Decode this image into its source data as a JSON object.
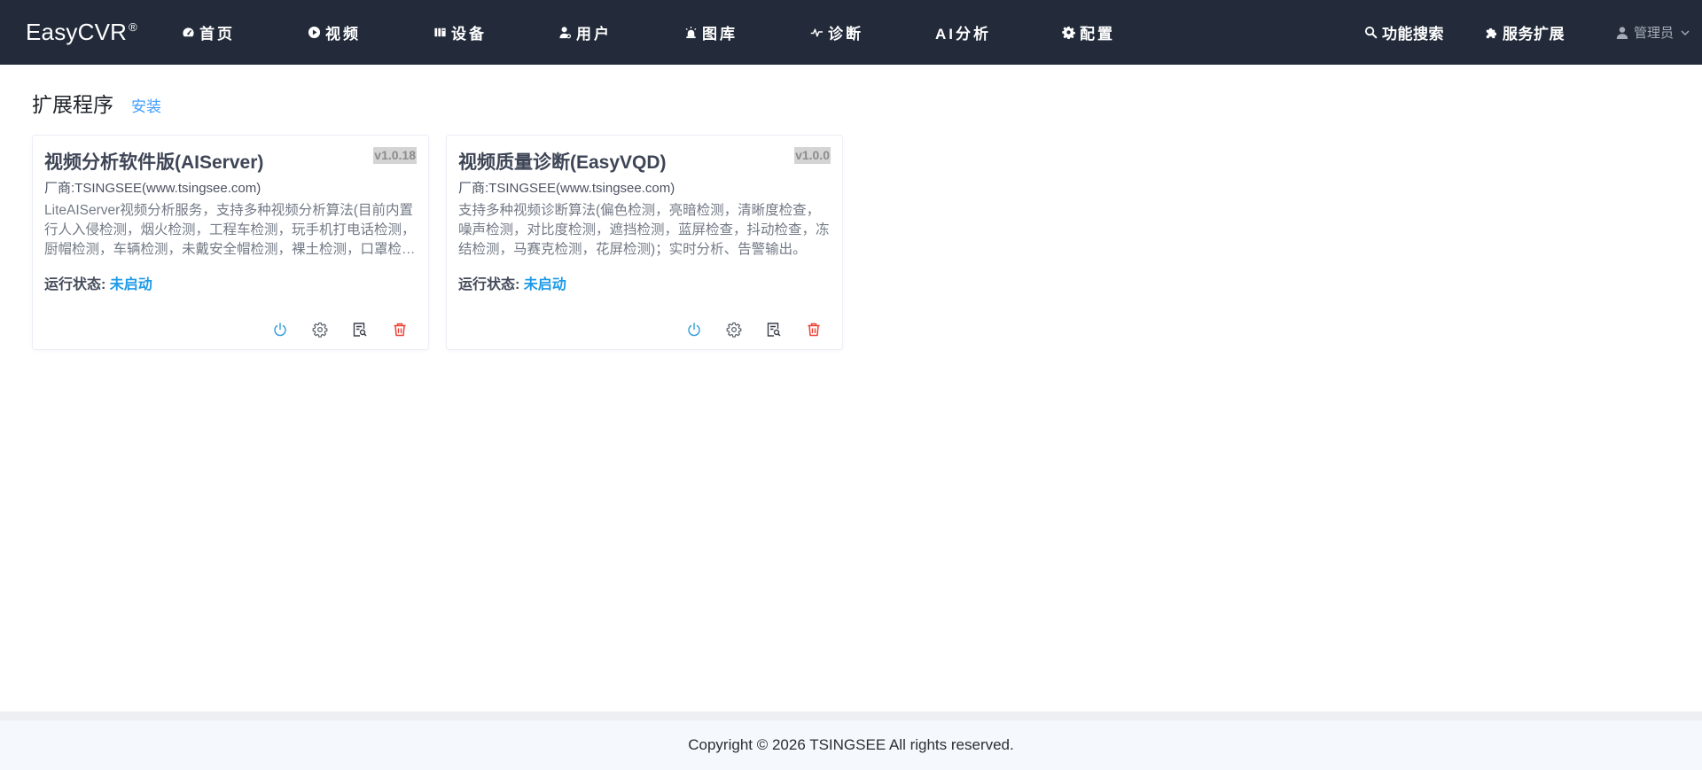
{
  "app": {
    "brand": "EasyCVR",
    "brand_mark": "®"
  },
  "nav": {
    "items": [
      {
        "label": "首页",
        "icon": "dashboard-icon"
      },
      {
        "label": "视频",
        "icon": "play-circle-icon"
      },
      {
        "label": "设备",
        "icon": "device-icon"
      },
      {
        "label": "用户",
        "icon": "user-icon"
      },
      {
        "label": "图库",
        "icon": "alarm-light-icon"
      },
      {
        "label": "诊断",
        "icon": "pulse-icon"
      },
      {
        "label": "AI分析",
        "icon": ""
      },
      {
        "label": "配置",
        "icon": "gear-icon"
      }
    ],
    "search_label": "功能搜索",
    "extensions_label": "服务扩展",
    "user_label": "管理员"
  },
  "page": {
    "title": "扩展程序",
    "install_label": "安装"
  },
  "cards": [
    {
      "name": "视频分析软件版(AIServer)",
      "version": "v1.0.18",
      "vendor": "厂商:TSINGSEE(www.tsingsee.com)",
      "description": "LiteAIServer视频分析服务，支持多种视频分析算法(目前内置行人入侵检测，烟火检测，工程车检测，玩手机打电话检测，厨帽检测，车辆检测，未戴安全帽检测，裸土检测，口罩检测等)",
      "status_label": "运行状态:",
      "status_value": "未启动"
    },
    {
      "name": "视频质量诊断(EasyVQD)",
      "version": "v1.0.0",
      "vendor": "厂商:TSINGSEE(www.tsingsee.com)",
      "description": "支持多种视频诊断算法(偏色检测，亮暗检测，清晰度检查，噪声检测，对比度检测，遮挡检测，蓝屏检查，抖动检查，冻结检测，马赛克检测，花屏检测)；实时分析、告警输出。",
      "status_label": "运行状态:",
      "status_value": "未启动"
    }
  ],
  "footer": {
    "copyright": "Copyright © 2026 TSINGSEE All rights reserved."
  },
  "colors": {
    "topbar": "#232b3a",
    "accent": "#409eff",
    "status": "#1d9ae8",
    "danger": "#f04134"
  }
}
